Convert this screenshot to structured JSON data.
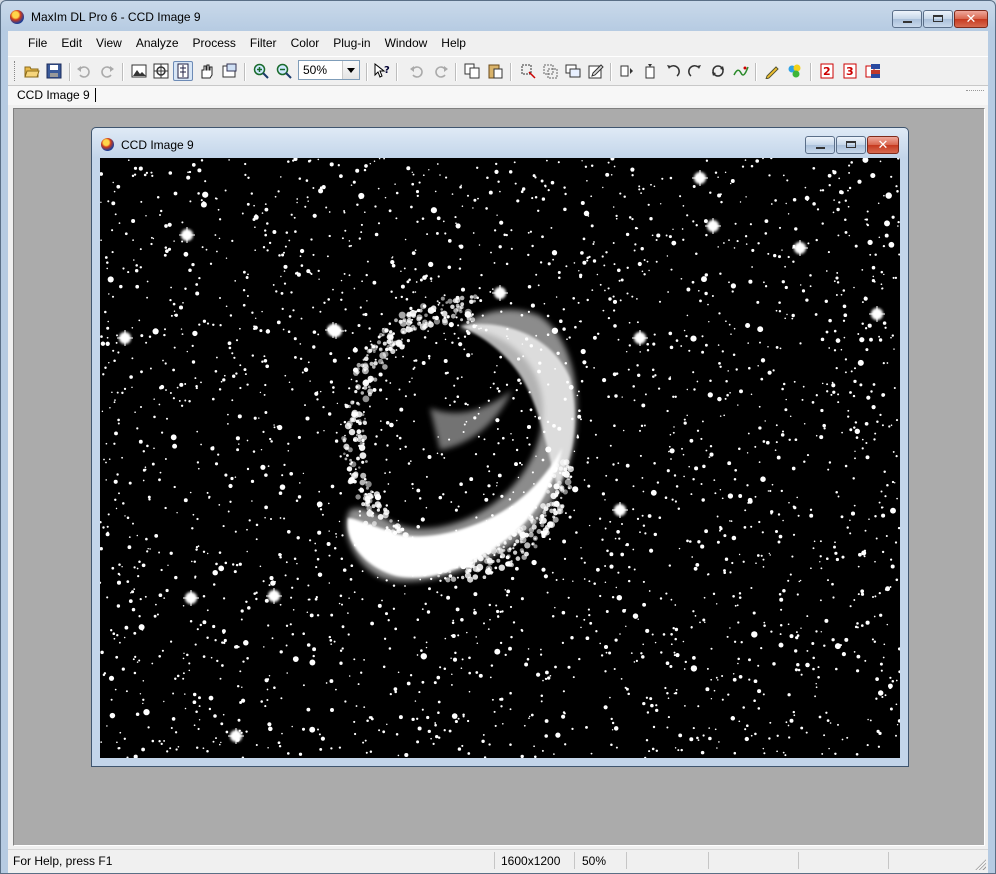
{
  "app": {
    "title": "MaxIm DL Pro 6 - CCD Image 9"
  },
  "menu": [
    "File",
    "Edit",
    "View",
    "Analyze",
    "Process",
    "Filter",
    "Color",
    "Plug-in",
    "Window",
    "Help"
  ],
  "toolbar": {
    "zoom": "50%",
    "icons": [
      "open-icon",
      "save-icon",
      "undo-icon",
      "redo-icon",
      "screen-stretch-icon",
      "crosshair-icon",
      "info-window-icon",
      "hand-icon",
      "image-info-icon",
      "zoom-in-icon",
      "zoom-out-icon",
      "help-pointer-icon",
      "undo-icon",
      "redo-icon",
      "copy-icon",
      "paste-icon",
      "select-icon",
      "crop-icon",
      "duplicate-icon",
      "edit-icon",
      "flip-icon",
      "rotate-icon",
      "rotate-ccw-icon",
      "rotate-cw-icon",
      "rotate-free-icon",
      "deconvolve-icon",
      "pencil-icon",
      "color-stack-icon",
      "calibrate-icon",
      "stack-icon",
      "combine-icon"
    ]
  },
  "tab": {
    "label": "CCD Image 9"
  },
  "document": {
    "title": "CCD Image 9"
  },
  "status": {
    "help": "For Help, press F1",
    "dimensions": "1600x1200",
    "zoom": "50%"
  },
  "colors": {
    "title_bar": "#b6cbe2",
    "close_button": "#c6391f",
    "mdi_background": "#ababab",
    "image_background": "#000000"
  }
}
